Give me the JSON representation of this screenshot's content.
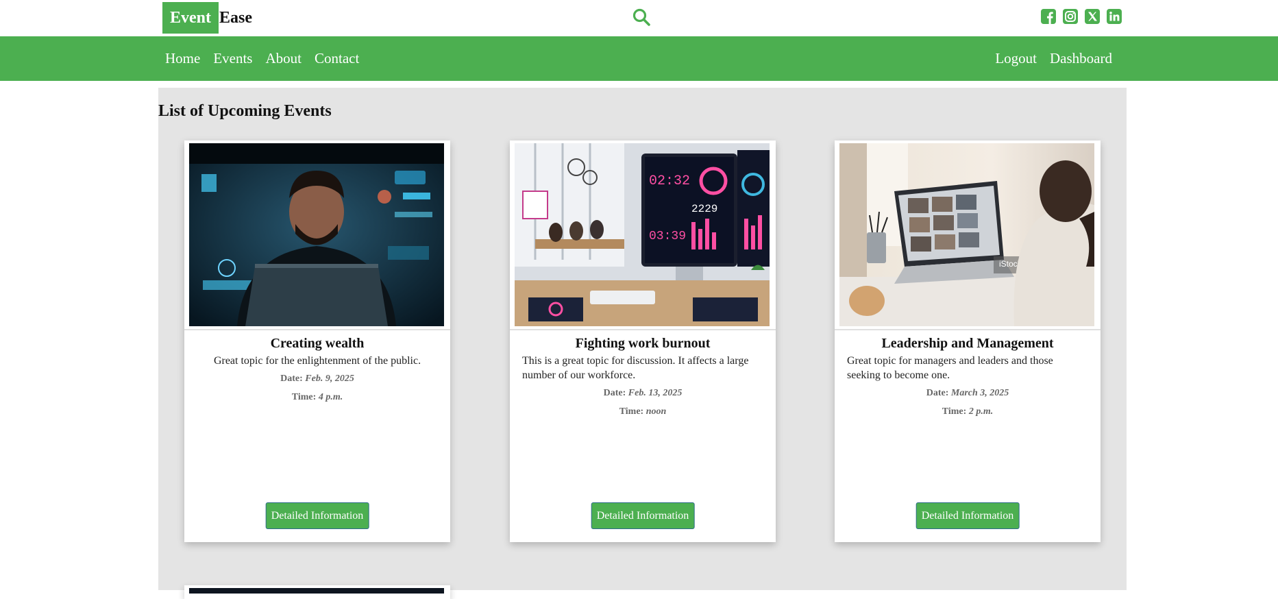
{
  "brand": {
    "part1": "Event",
    "part2": "Ease",
    "color": "#4caf50"
  },
  "icons": {
    "search": "search-icon",
    "socials": [
      "facebook-icon",
      "instagram-icon",
      "x-twitter-icon",
      "linkedin-icon"
    ]
  },
  "nav": {
    "left": [
      "Home",
      "Events",
      "About",
      "Contact"
    ],
    "right": [
      "Logout",
      "Dashboard"
    ]
  },
  "main": {
    "title": "List of Upcoming Events",
    "date_label": "Date:",
    "time_label": "Time:",
    "events": [
      {
        "title": "Creating wealth",
        "description": "Great topic for the enlightenment of the public.",
        "date": "Feb. 9, 2025",
        "time": "4 p.m.",
        "image": "man-working-on-laptop-with-holographic-interfaces",
        "button": "Detailed Information"
      },
      {
        "title": "Fighting work burnout",
        "description": "This is a great topic for discussion. It affects a large number of our workforce.",
        "date": "Feb. 13, 2025",
        "time": "noon",
        "image": "event-management-dashboard-in-office",
        "button": "Detailed Information"
      },
      {
        "title": "Leadership and Management",
        "description": "Great topic for managers and leaders and those seeking to become one.",
        "date": "March 3, 2025",
        "time": "2 p.m.",
        "image": "woman-on-video-call-on-laptop",
        "button": "Detailed Information"
      }
    ]
  }
}
